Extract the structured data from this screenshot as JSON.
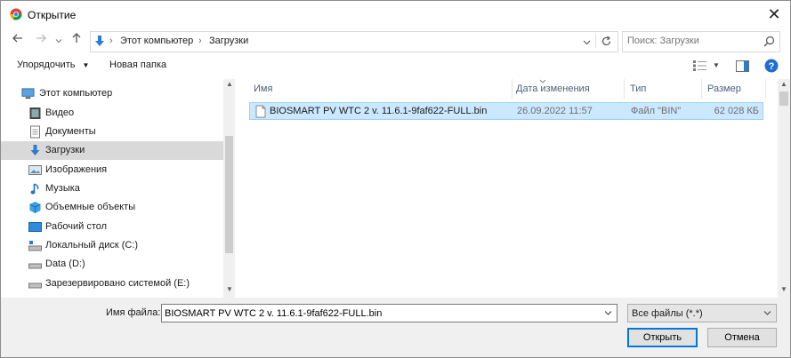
{
  "window": {
    "title": "Открытие",
    "close_glyph": "✕"
  },
  "address": {
    "path": [
      "Этот компьютер",
      "Загрузки"
    ],
    "search_placeholder": "Поиск: Загрузки"
  },
  "toolbar": {
    "organize_label": "Упорядочить",
    "new_folder_label": "Новая папка"
  },
  "sidebar": {
    "items": [
      {
        "label": "Этот компьютер",
        "icon": "computer-icon"
      },
      {
        "label": "Видео",
        "icon": "video-icon"
      },
      {
        "label": "Документы",
        "icon": "documents-icon"
      },
      {
        "label": "Загрузки",
        "icon": "downloads-icon",
        "selected": true
      },
      {
        "label": "Изображения",
        "icon": "pictures-icon"
      },
      {
        "label": "Музыка",
        "icon": "music-icon"
      },
      {
        "label": "Объемные объекты",
        "icon": "3d-objects-icon"
      },
      {
        "label": "Рабочий стол",
        "icon": "desktop-icon"
      },
      {
        "label": "Локальный диск (C:)",
        "icon": "drive-c-icon"
      },
      {
        "label": "Data (D:)",
        "icon": "drive-icon"
      },
      {
        "label": "Зарезервировано системой (E:)",
        "icon": "drive-icon"
      }
    ]
  },
  "files": {
    "columns": {
      "name": "Имя",
      "date": "Дата изменения",
      "type": "Тип",
      "size": "Размер"
    },
    "rows": [
      {
        "name": "BIOSMART PV WTC 2 v. 11.6.1-9faf622-FULL.bin",
        "date": "26.09.2022 11:57",
        "type": "Файл \"BIN\"",
        "size": "62 028 КБ"
      }
    ]
  },
  "bottom": {
    "filename_label": "Имя файла:",
    "filename_value": "BIOSMART PV WTC 2 v. 11.6.1-9faf622-FULL.bin",
    "filter_value": "Все файлы (*.*)",
    "open_label": "Открыть",
    "cancel_label": "Отмена"
  },
  "colors": {
    "selection": "#cce8ff",
    "selection_border": "#99d1ff",
    "accent": "#0078d7"
  }
}
